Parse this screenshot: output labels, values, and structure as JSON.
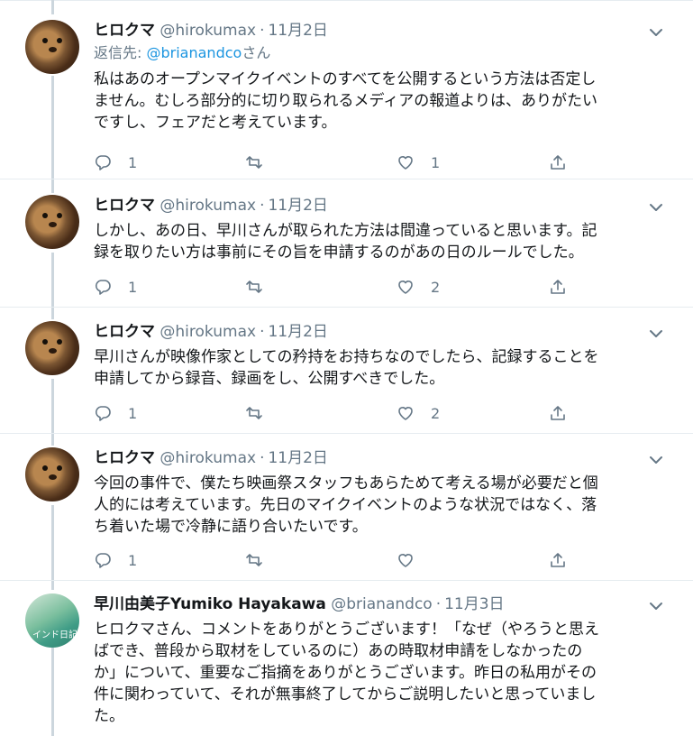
{
  "tweets": [
    {
      "name": "ヒロクマ",
      "handle": "@hirokumax",
      "sep": "·",
      "date": "11月2日",
      "reply_label": "返信先:",
      "reply_handle": "@brianandco",
      "reply_suffix": "さん",
      "text": "私はあのオープンマイクイベントのすべてを公開するという方法は否定し\nません。むしろ部分的に切り取られるメディアの報道よりは、ありがたい\nですし、フェアだと考えています。",
      "reply_count": "1",
      "retweet_count": "",
      "like_count": "1"
    },
    {
      "name": "ヒロクマ",
      "handle": "@hirokumax",
      "sep": "·",
      "date": "11月2日",
      "text": "しかし、あの日、早川さんが取られた方法は間違っていると思います。記\n録を取りたい方は事前にその旨を申請するのがあの日のルールでした。",
      "reply_count": "1",
      "retweet_count": "",
      "like_count": "2"
    },
    {
      "name": "ヒロクマ",
      "handle": "@hirokumax",
      "sep": "·",
      "date": "11月2日",
      "text": "早川さんが映像作家としての矜持をお持ちなのでしたら、記録することを\n申請してから録音、録画をし、公開すべきでした。",
      "reply_count": "1",
      "retweet_count": "",
      "like_count": "2"
    },
    {
      "name": "ヒロクマ",
      "handle": "@hirokumax",
      "sep": "·",
      "date": "11月2日",
      "text": "今回の事件で、僕たち映画祭スタッフもあらためて考える場が必要だと個\n人的には考えています。先日のマイクイベントのような状況ではなく、落\nち着いた場で冷静に語り合いたいです。",
      "reply_count": "1",
      "retweet_count": "",
      "like_count": ""
    },
    {
      "name": "早川由美子Yumiko Hayakawa",
      "handle": "@brianandco",
      "sep": "·",
      "date": "11月3日",
      "avatar_text": "インド日記",
      "text": "ヒロクマさん、コメントをありがとうございます！「なぜ（やろうと思え\nばでき、普段から取材をしているのに）あの時取材申請をしなかったの\nか」について、重要なご指摘をありがとうございます。昨日の私用がその\n件に関わっていて、それが無事終了してからご説明したいと思っていまし\nた。"
    }
  ],
  "icons": {
    "reply": "reply-icon",
    "retweet": "retweet-icon",
    "like": "heart-icon",
    "share": "share-icon",
    "caret": "chevron-down-icon"
  },
  "colors": {
    "secondary_text": "#657786",
    "link": "#1b95e0",
    "thread_line": "#ccd6dd",
    "divider": "#e6ecf0"
  }
}
